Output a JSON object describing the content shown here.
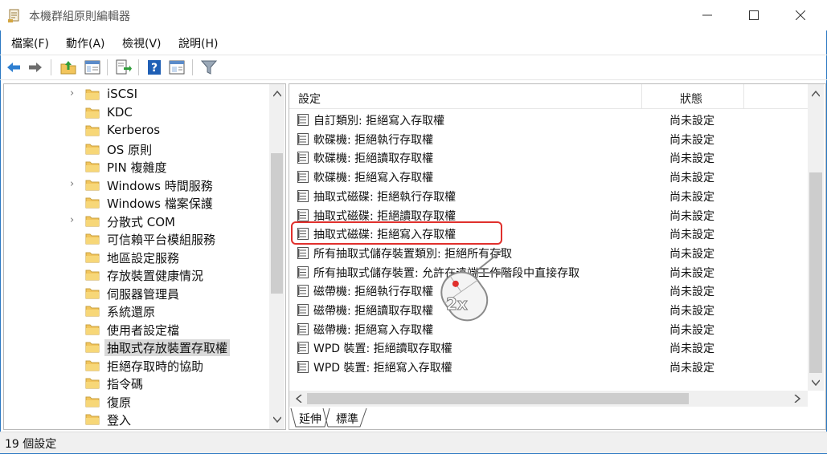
{
  "window": {
    "title": "本機群組原則編輯器"
  },
  "menu": [
    "檔案(F)",
    "動作(A)",
    "檢視(V)",
    "說明(H)"
  ],
  "toolbar_icons": [
    "back-arrow-icon",
    "forward-arrow-icon",
    "up-folder-icon",
    "show-hide-tree-icon",
    "export-list-icon",
    "help-icon",
    "properties-icon",
    "filter-icon"
  ],
  "tree": [
    {
      "label": "iSCSI",
      "expander": "›"
    },
    {
      "label": "KDC",
      "expander": ""
    },
    {
      "label": "Kerberos",
      "expander": ""
    },
    {
      "label": "OS 原則",
      "expander": ""
    },
    {
      "label": "PIN 複雜度",
      "expander": ""
    },
    {
      "label": "Windows 時間服務",
      "expander": "›"
    },
    {
      "label": "Windows 檔案保護",
      "expander": ""
    },
    {
      "label": "分散式 COM",
      "expander": "›"
    },
    {
      "label": "可信賴平台模組服務",
      "expander": ""
    },
    {
      "label": "地區設定服務",
      "expander": ""
    },
    {
      "label": "存放裝置健康情況",
      "expander": ""
    },
    {
      "label": "伺服器管理員",
      "expander": ""
    },
    {
      "label": "系統還原",
      "expander": ""
    },
    {
      "label": "使用者設定檔",
      "expander": ""
    },
    {
      "label": "抽取式存放裝置存取權",
      "expander": "",
      "selected": true
    },
    {
      "label": "拒絕存取時的協助",
      "expander": ""
    },
    {
      "label": "指令碼",
      "expander": ""
    },
    {
      "label": "復原",
      "expander": ""
    },
    {
      "label": "登入",
      "expander": ""
    }
  ],
  "list": {
    "col_setting": "設定",
    "col_state": "狀態",
    "rows": [
      {
        "name": "自訂類別: 拒絕寫入存取權",
        "state": "尚未設定"
      },
      {
        "name": "軟碟機: 拒絕執行存取權",
        "state": "尚未設定"
      },
      {
        "name": "軟碟機: 拒絕讀取存取權",
        "state": "尚未設定"
      },
      {
        "name": "軟碟機: 拒絕寫入存取權",
        "state": "尚未設定"
      },
      {
        "name": "抽取式磁碟: 拒絕執行存取權",
        "state": "尚未設定"
      },
      {
        "name": "抽取式磁碟: 拒絕讀取存取權",
        "state": "尚未設定"
      },
      {
        "name": "抽取式磁碟: 拒絕寫入存取權",
        "state": "尚未設定",
        "highlighted": true
      },
      {
        "name": "所有抽取式儲存裝置類別: 拒絕所有存取",
        "state": "尚未設定"
      },
      {
        "name": "所有抽取式儲存裝置: 允許在遠端工作階段中直接存取",
        "state": "尚未設定"
      },
      {
        "name": "磁帶機: 拒絕執行存取權",
        "state": "尚未設定"
      },
      {
        "name": "磁帶機: 拒絕讀取存取權",
        "state": "尚未設定"
      },
      {
        "name": "磁帶機: 拒絕寫入存取權",
        "state": "尚未設定"
      },
      {
        "name": "WPD 裝置: 拒絕讀取存取權",
        "state": "尚未設定"
      },
      {
        "name": "WPD 裝置: 拒絕寫入存取權",
        "state": "尚未設定"
      }
    ]
  },
  "tabs": [
    "延伸",
    "標準"
  ],
  "status": "19 個設定",
  "overlay": {
    "badge": "2x"
  },
  "colors": {
    "accent_border": "#2b79c2",
    "highlight": "#e0302c",
    "folder": "#f2c55c"
  }
}
